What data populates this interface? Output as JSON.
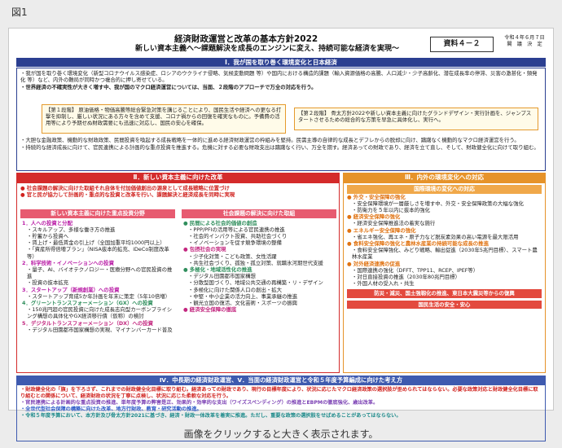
{
  "figure_label": "図1",
  "caption": "画像をクリックすると大きく表示されます。",
  "doc": {
    "title": "経済財政運営と改革の基本方針2022",
    "subtitle": "新しい資本主義へ～課題解決を成長のエンジンに変え、持続可能な経済を実現～",
    "badge": "資料４－２",
    "date_line1": "令和４年６月７日",
    "date_line2": "閣　議　決　定",
    "sec1": {
      "header": "Ⅰ．我が国を取り巻く環境変化と日本経済",
      "p1": "・我が国を取り巻く環境変化（新型コロナウイルス感染症、ロシアのウクライナ侵略、気候変動問題 等）や国内における構造的課題（輸入資源価格の高騰、人口減少・少子高齢化、潜在成長率の停滞、災害の激甚化・頻発化 等）など、内外の難局が同時かつ複合的に押し寄せている。",
      "p2": "・世界経済の不確実性が大きく増す中、我が国のマクロ経済運営については、当面、２段階のアプローチで万全の対応を行う。",
      "stage1": "【第１段階】 原油価格・物価高騰等総合緊急対策を講じることにより、国民生活や経済への更なる打撃を抑制し、厳しい状況にある方々を含めて支援、コロナ禍からの回復を確実なものに。予備費の活用等により予期せぬ財政需要にも迅速に対応し、国民の安心を確保。",
      "stage2": "【第２段階】 骨太方針2022や新しい資本主義に向けたグランドデザイン・実行計画を、ジャンプスタートさせるための総合的な方策を早急に具体化し、実行へ。",
      "p3": "・大胆な金融政策、機動的な財政政策、民間投資を喚起する成長戦略を一体的に進める経済財政運営の枠組みを堅持。民需主導の自律的な成長とデフレからの脱却に向け、躊躇なく機動的なマクロ経済運営を行う。",
      "p4": "・持続的な経済成長に向けて、官民連携による計画的な重点投資を推進する。危機に対する必要な財政支出は躊躇なく行い、万全を期す。経済あっての財政であり、経済を立て直し、そして、財政健全化に向けて取り組む。"
    },
    "sec2": {
      "header": "Ⅱ．新しい資本主義に向けた改革",
      "lead1": "● 社会課題の解決に向けた取組それ自体を付加価値創出の源泉として成長戦略に位置づけ",
      "lead2": "● 官と民が協力して計画的・重点的な投資と改革を行い、課題解決と経済成長を同時に実現",
      "left_bar": "新しい資本主義に向けた重点投資分野",
      "right_bar": "社会課題の解決に向けた取組",
      "left_items": [
        {
          "h": "1．人への投資と分配",
          "lines": [
            "・スキルアップ、多様な働き方の推進",
            "・貯蓄から投資へ",
            "・賃上げ・最低賃金の引上げ（全国加重平均1000円以上）",
            "・「資産所得倍増プラン」（NISA抜本的拡充、iDeCo制度改革等）"
          ]
        },
        {
          "h": "2．科学技術・イノベーションへの投資",
          "lines": [
            "・量子、AI、バイオテクノロジー・医療分野への官民投資の推進",
            "・投資の抜本拡充"
          ]
        },
        {
          "h": "3．スタートアップ（新規創業）への投資",
          "lines": [
            "・スタートアップ育成5か年計画を年末に策定（5年10倍増）"
          ]
        },
        {
          "h": "4．グリーントランスフォーメーション（GX）への投資",
          "lines": [
            "・150兆円超の官民投資に向けた成長志向型カーボンプライシング構想の具体化やGX経済移行債（仮称）の検討"
          ]
        },
        {
          "h": "5．デジタルトランスフォーメーション（DX）への投資",
          "lines": [
            "・デジタル田園都市国家構想の実現、マイナンバーカード普及"
          ]
        }
      ],
      "right_items": [
        {
          "h": "● 民間による社会的価値の創造",
          "lines": [
            "・PPP/PFIの活用等による官民連携の推進",
            "・社会的インパクト投資、共助社会づくり",
            "・イノベーションを促す競争環境の整備"
          ]
        },
        {
          "h": "● 包摂社会の実現",
          "lines": [
            "・少子化対策・こども政策、女性活躍",
            "・共生社会づくり、孤独・孤立対策、就職氷河期世代支援"
          ]
        },
        {
          "h": "● 多極化・地域活性化の推進",
          "lines": [
            "・デジタル田園都市国家構想",
            "・分散型国づくり、地域公共交通の再構築・リ・デザイン",
            "・多極化に向けた関係人口の創出・拡大",
            "・中堅・中小企業の活力向上、事業承継の推進",
            "・観光立国の復活、文化芸術・スポーツの振興"
          ]
        },
        {
          "h": "● 経済安全保障の徹底",
          "lines": []
        }
      ]
    },
    "sec3": {
      "header": "Ⅲ．内外の環境変化への対応",
      "bar": "国際環境の変化への対応",
      "items": [
        {
          "h": "● 外交・安全保障の強化",
          "lines": [
            "・安全保障環境が一層厳しさを増す中、外交・安全保障政策の大幅な強化",
            "・防衛力を５年以内に抜本的強化"
          ]
        },
        {
          "h": "● 経済安全保障の強化",
          "lines": [
            "・経済安全保障推進法の着実な施行"
          ]
        },
        {
          "h": "● エネルギー安全保障の強化",
          "lines": [
            "・省エネ強化、再エネ・原子力など脱炭素効果の高い電源を最大限活用"
          ]
        },
        {
          "h": "● 食料安全保障の強化と農林水産業の持続可能な成長の推進",
          "lines": [
            "・食料安全保障強化、みどり戦略、輸出促進（2030年5兆円目標）、スマート農林水産業"
          ]
        },
        {
          "h": "● 対外経済連携の促進",
          "lines": [
            "・国際連携の強化（DFFT、TPP11、RCEP、IPEF等）",
            "・対日直接投資の推進（2030年80兆円目標）",
            "・外国人材の受入れ・共生"
          ]
        }
      ],
      "band1": "防災・減災、国土強靱化の推進、東日本大震災等からの復興",
      "band2": "国民生活の安全・安心"
    },
    "sec4": {
      "header": "Ⅳ．中長期の経済財政運営、Ⅴ．当面の経済財政運営と令和５年度予算編成に向けた考え方",
      "lines": [
        "・財政健全化の「旗」を下ろさず、これまでの財政健全化目標に取り組む。経済あっての財政であり、現行の目標年度により、状況に応じたマクロ経済政策の選択肢が歪められてはならない。必要な政策対応と財政健全化目標に取り組むとの関係について、経済財政の状況を丁寧に点検し、状況に応じた柔軟な対応を行う。",
        "・官民連携による計画的な重点投資の推進、単年度予算の弊害是正、効果的・効率的な支出（ワイズスペンディング）の推進とEBPMの徹底強化、歳出改革。",
        "・全世代型社会保障の構築に向けた改革、地方行財政、教育・研究活動の推進。",
        "・令和５年度予算において、本方針及び骨太方針2021に基づき、経済・財政一体改革を着実に推進。ただし、重要な政策の選択肢をせばめることがあってはならない。"
      ]
    }
  }
}
